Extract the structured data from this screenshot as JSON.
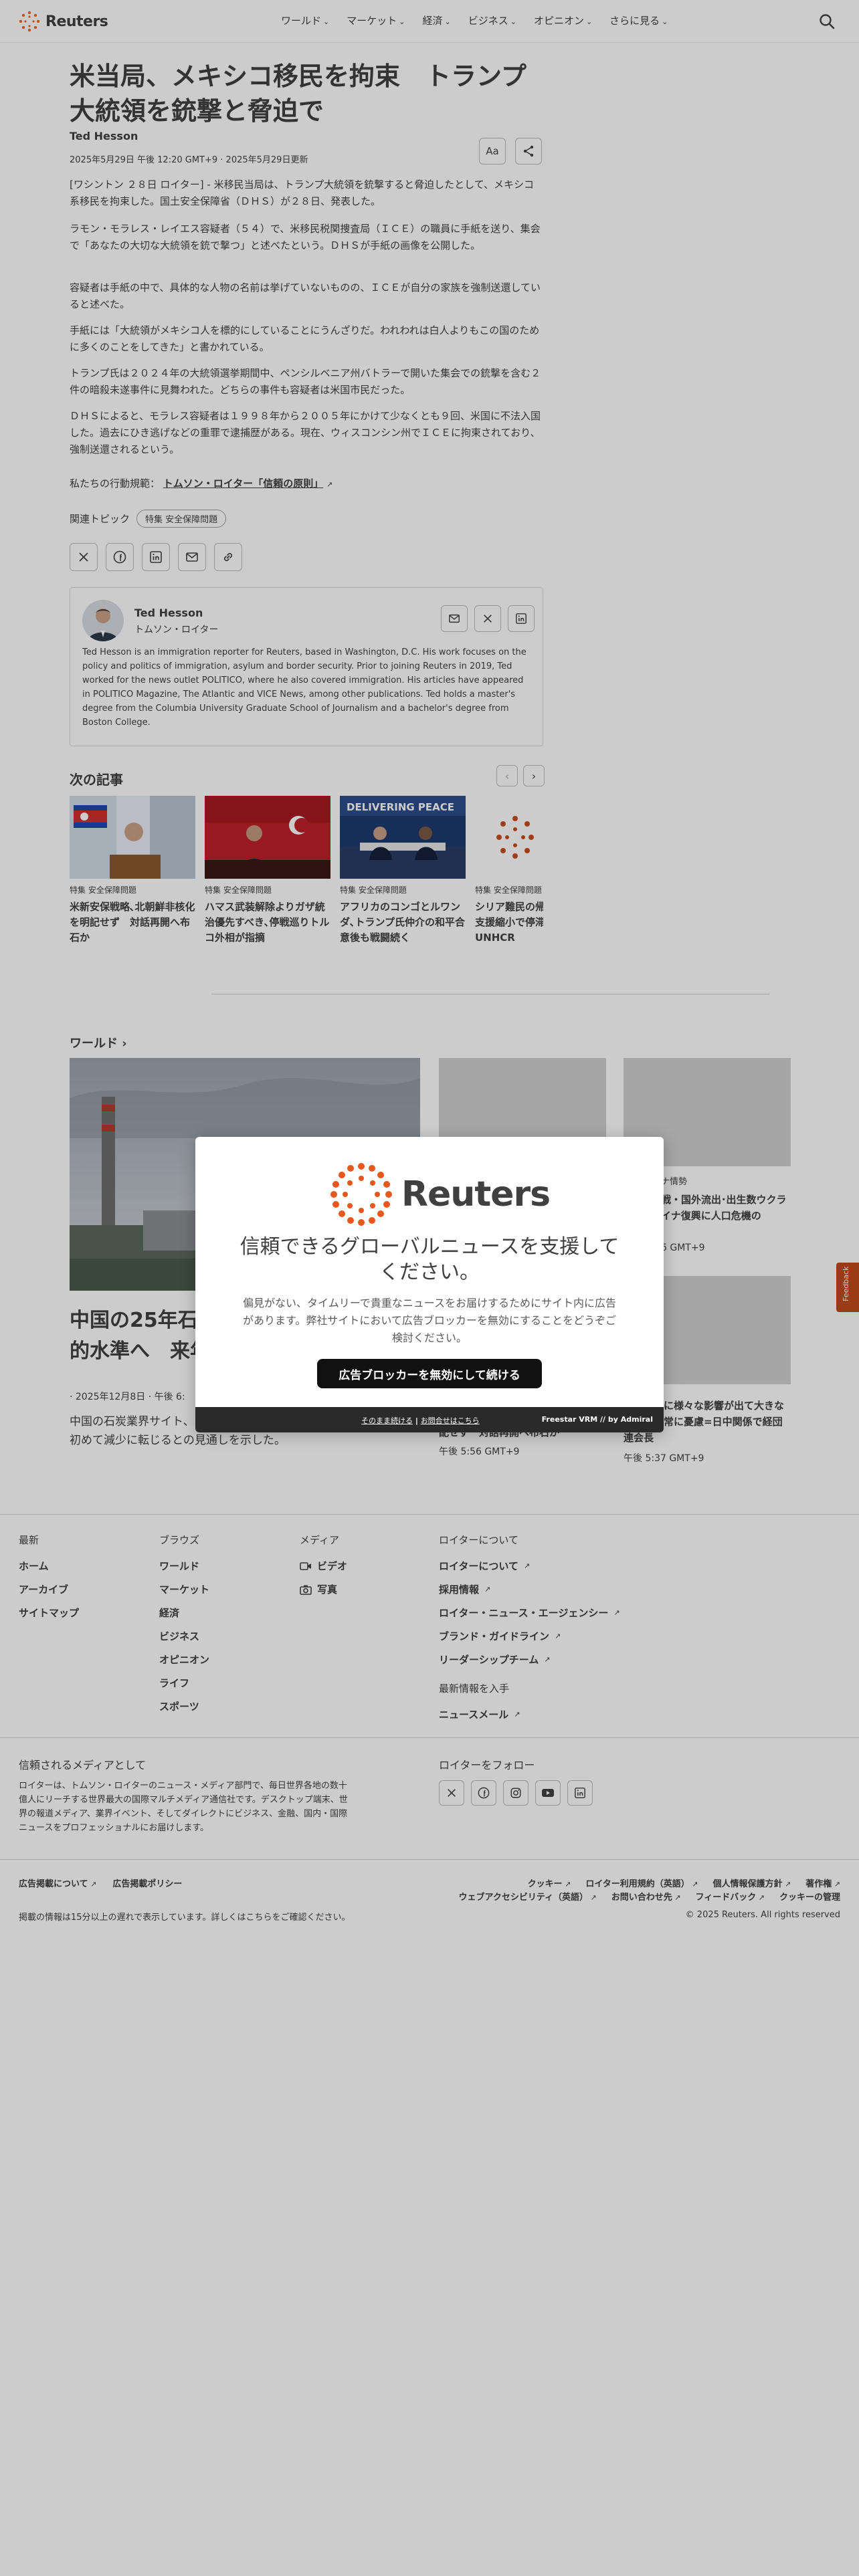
{
  "header": {
    "logo_text": "Reuters",
    "nav": [
      "ワールド",
      "マーケット",
      "経済",
      "ビジネス",
      "オピニオン",
      "さらに見る"
    ]
  },
  "article": {
    "headline": "米当局、メキシコ移民を拘束　トランプ大統領を銃撃と脅迫で",
    "author": "Ted Hesson",
    "date": "2025年5月29日 午後 12:20 GMT+9 · 2025年5月29日更新",
    "font_button": "Aa",
    "paragraphs": [
      "[ワシントン ２８日 ロイター] - 米移民当局は、トランプ大統領を銃撃すると脅迫したとして、メキシコ系移民を拘束した。国土安全保障省（ＤＨＳ）が２８日、発表した。",
      "ラモン・モラレス・レイエス容疑者（５４）で、米移民税関捜査局（ＩＣＥ）の職員に手紙を送り、集会で「あなたの大切な大統領を銃で撃つ」と述べたという。ＤＨＳが手紙の画像を公開した。",
      "容疑者は手紙の中で、具体的な人物の名前は挙げていないものの、ＩＣＥが自分の家族を強制送還していると述べた。",
      "手紙には「大統領がメキシコ人を標的にしていることにうんざりだ。われわれは白人よりもこの国のために多くのことをしてきた」と書かれている。",
      "トランプ氏は２０２４年の大統領選挙期間中、ペンシルベニア州バトラーで開いた集会での銃撃を含む２件の暗殺未遂事件に見舞われた。どちらの事件も容疑者は米国市民だった。",
      "ＤＨＳによると、モラレス容疑者は１９９８年から２００５年にかけて少なくとも９回、米国に不法入国した。過去にひき逃げなどの重罪で逮捕歴がある。現在、ウィスコンシン州でＩＣＥに拘束されており、強制送還されるという。"
    ],
    "principles_label": "私たちの行動規範：",
    "principles_link": "トムソン・ロイター「信頼の原則」",
    "topics_label": "関連トピック",
    "topic_chip": "特集 安全保障問題"
  },
  "author_card": {
    "name": "Ted Hesson",
    "org": "トムソン・ロイター",
    "bio": "Ted Hesson is an immigration reporter for Reuters, based in Washington, D.C. His work focuses on the policy and politics of immigration, asylum and border security. Prior to joining Reuters in 2019, Ted worked for the news outlet POLITICO, where he also covered immigration. His articles have appeared in POLITICO Magazine, The Atlantic and VICE News, among other publications. Ted holds a master's degree from the Columbia University Graduate School of Journalism and a bachelor's degree from Boston College."
  },
  "next_articles": {
    "heading": "次の記事",
    "cards": [
      {
        "tag": "特集 安全保障問題",
        "title": "米新安保戦略､北朝鮮非核化を明記せず　対話再開へ布石か"
      },
      {
        "tag": "特集 安全保障問題",
        "title": "ハマス武装解除よりガザ統治優先すべき､停戦巡りトルコ外相が指摘"
      },
      {
        "tag": "特集 安全保障問題",
        "title": "アフリカのコンゴとルワンダ､トランプ氏仲介の和平合意後も戦闘続く"
      },
      {
        "tag": "特集 安全保障問題",
        "title": "シリア難民の帰還人道的な支援縮小で停滞する恐れ＝UNHCR"
      }
    ]
  },
  "world": {
    "section_title": "ワールド",
    "lead_title": "中国の25年石炭生産、過去最高の記録的水準へ　来年は増加の見通し",
    "lead_date": "· 2025年12月8日 · 午後 6:",
    "lead_desc": "中国の石炭業界サイト、２０２５年の石炭消費量が２０１７年以降で初めて減少に転じるとの見通しを示した。",
    "side": [
      {
        "label": "ナ情勢",
        "title": "戦・国外流出･出生数ウクライナ復興に人口危機の",
        "time": "6 GMT+9"
      },
      {
        "label": "",
        "title": "配せず　対話再開へ布石か",
        "time": "午後 5:56 GMT+9"
      },
      {
        "label": "",
        "title": "ビジネスに様々な影響が出て大きな影響を非常に憂慮=日中関係で経団連会長",
        "time": "午後 5:37 GMT+9"
      }
    ],
    "feedback": "Feedback"
  },
  "footer": {
    "cols": [
      {
        "title": "最新",
        "links": [
          "ホーム",
          "アーカイブ",
          "サイトマップ"
        ]
      },
      {
        "title": "ブラウズ",
        "links": [
          "ワールド",
          "マーケット",
          "経済",
          "ビジネス",
          "オピニオン",
          "ライフ",
          "スポーツ"
        ]
      },
      {
        "title": "メディア",
        "links": [
          "ビデオ",
          "写真"
        ]
      },
      {
        "title": "ロイターについて",
        "links": [
          "ロイターについて",
          "採用情報",
          "ロイター・ニュース・エージェンシー",
          "ブランド・ガイドライン",
          "リーダーシップチーム"
        ]
      }
    ],
    "newsletter_title": "最新情報を入手",
    "newsletter_link": "ニュースメール",
    "trusted_title": "信頼されるメディアとして",
    "trusted_desc": "ロイターは、トムソン・ロイターのニュース・メディア部門で、毎日世界各地の数十億人にリーチする世界最大の国際マルチメディア通信社です。デスクトップ端末、世界の報道メディア、業界イベント、そしてダイレクトにビジネス、金融、国内・国際ニュースをプロフェッショナルにお届けします。",
    "follow_title": "ロイターをフォロー",
    "legal_left": [
      "広告掲載について",
      "広告掲載ポリシー"
    ],
    "legal_right1": [
      "クッキー",
      "ロイター利用規約（英語）",
      "個人情報保護方針",
      "著作権"
    ],
    "legal_right2": [
      "ウェブアクセシビリティ（英語）",
      "お問い合わせ先",
      "フィードバック",
      "クッキーの管理"
    ],
    "disclaimer": "掲載の情報は15分以上の遅れで表示しています。詳しくはこちらをご確認ください。",
    "copyright": "© 2025 Reuters. All rights reserved"
  },
  "modal": {
    "logo_text": "Reuters",
    "title": "信頼できるグローバルニュースを支援してください。",
    "desc": "偏見がない、タイムリーで貴重なニュースをお届けするためにサイト内に広告があります。弊社サイトにおいて広告ブロッカーを無効にすることをどうぞご検討ください。",
    "button": "広告ブロッカーを無効にして続ける",
    "foot_link1": "そのまま続ける",
    "foot_sep": " | ",
    "foot_link2": "お問合せはこちら",
    "brand": "Freestar VRM  //  by Admiral"
  },
  "colors": {
    "accent": "#c04a1a",
    "text": "#404040",
    "button": "#111111"
  }
}
